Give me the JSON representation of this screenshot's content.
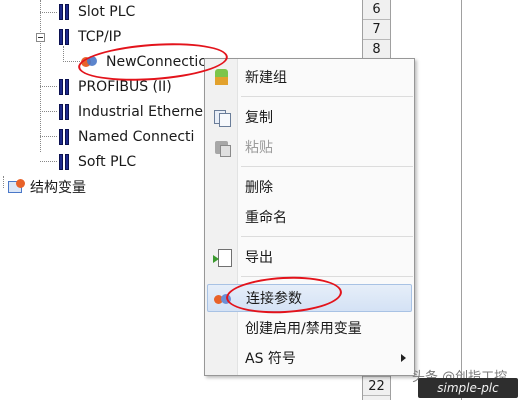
{
  "tree": {
    "items": [
      {
        "label": "Slot PLC",
        "icon": "plc-station-icon"
      },
      {
        "label": "TCP/IP",
        "icon": "plc-station-icon"
      },
      {
        "label": "NewConnectic",
        "icon": "connection-icon"
      },
      {
        "label": "PROFIBUS (II)",
        "icon": "plc-station-icon"
      },
      {
        "label": "Industrial Etherne",
        "icon": "plc-station-icon"
      },
      {
        "label": "Named Connecti",
        "icon": "plc-station-icon"
      },
      {
        "label": "Soft PLC",
        "icon": "plc-station-icon"
      },
      {
        "label": "结构变量",
        "icon": "struct-variable-icon"
      }
    ]
  },
  "grid": {
    "row_numbers": [
      "6",
      "7",
      "8",
      "22"
    ]
  },
  "context_menu": {
    "items": [
      {
        "label": "新建组",
        "icon": "new-group-icon",
        "enabled": true
      },
      {
        "label": "复制",
        "icon": "copy-icon",
        "enabled": true
      },
      {
        "label": "粘贴",
        "icon": "paste-icon",
        "enabled": false
      },
      {
        "label": "删除",
        "icon": "",
        "enabled": true
      },
      {
        "label": "重命名",
        "icon": "",
        "enabled": true
      },
      {
        "label": "导出",
        "icon": "export-icon",
        "enabled": true
      },
      {
        "label": "连接参数",
        "icon": "connection-params-icon",
        "enabled": true,
        "highlighted": true
      },
      {
        "label": "创建启用/禁用变量",
        "icon": "",
        "enabled": true
      },
      {
        "label": "AS 符号",
        "icon": "",
        "enabled": true,
        "has_submenu": true
      }
    ]
  },
  "watermark": {
    "text": "头条 @创指工控",
    "box_text": "simple-plc"
  },
  "colors": {
    "annotation_red": "#e3131b",
    "highlight_bg": "#d4e2f5",
    "plc_icon_blue": "#1e2a8c"
  }
}
